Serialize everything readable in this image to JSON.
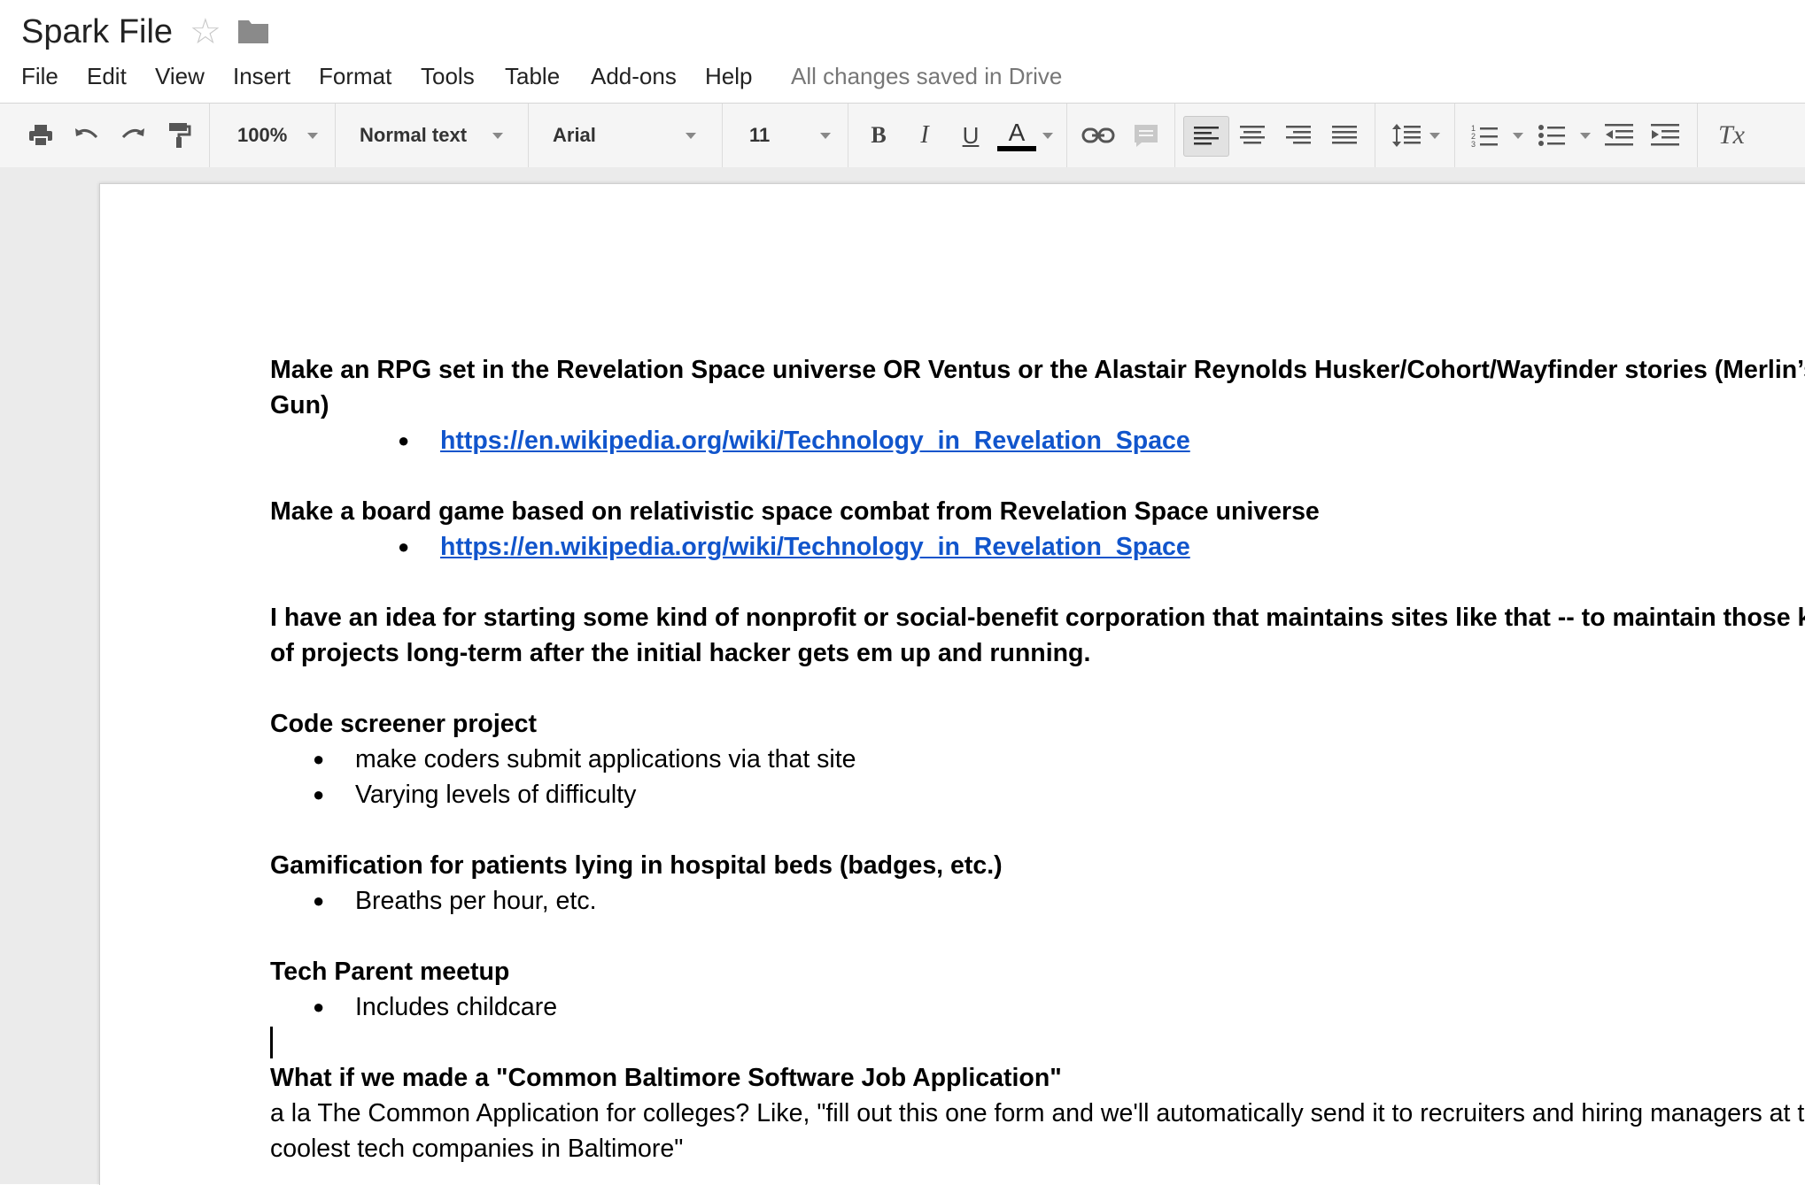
{
  "app": {
    "title": "Spark File",
    "save_status": "All changes saved in Drive"
  },
  "menu": [
    "File",
    "Edit",
    "View",
    "Insert",
    "Format",
    "Tools",
    "Table",
    "Add-ons",
    "Help"
  ],
  "toolbar": {
    "zoom": "100%",
    "style": "Normal text",
    "font": "Arial",
    "font_size": "11",
    "bold_label": "B",
    "italic_label": "I",
    "underline_label": "U",
    "text_color_label": "A",
    "clear_format_label": "Tx",
    "text_color": "#000000",
    "icons": [
      "print-icon",
      "undo-icon",
      "redo-icon",
      "paint-format-icon",
      "link-icon",
      "comment-icon",
      "align-left-icon",
      "align-center-icon",
      "align-right-icon",
      "align-justify-icon",
      "line-spacing-icon",
      "numbered-list-icon",
      "bulleted-list-icon",
      "decrease-indent-icon",
      "increase-indent-icon",
      "clear-formatting-icon"
    ]
  },
  "document": {
    "p1": "Make an RPG set in the Revelation Space universe OR Ventus or the Alastair Reynolds Husker/Cohort/Wayfinder stories (Merlin’s Gun)",
    "p1_link": "https://en.wikipedia.org/wiki/Technology_in_Revelation_Space",
    "p2": "Make a board game based on relativistic space combat from Revelation Space universe",
    "p2_link": "https://en.wikipedia.org/wiki/Technology_in_Revelation_Space",
    "p3": "I have an idea for starting some kind of nonprofit or social-benefit corporation that maintains sites like that -- to maintain those kinds of projects long-term after the initial hacker gets em up and running.",
    "p4": "Code screener project",
    "p4_bullets": [
      "make coders submit applications via that site",
      "Varying levels of difficulty"
    ],
    "p5": "Gamification for patients lying in hospital beds (badges, etc.)",
    "p5_bullets": [
      "Breaths per hour, etc."
    ],
    "p6": "Tech Parent meetup",
    "p6_bullets": [
      "Includes childcare"
    ],
    "p7": "What if we made a \"Common Baltimore Software Job Application\"",
    "p8": "a la The Common Application for colleges? Like, \"fill out this one form and we'll automatically send it to recruiters and hiring managers at the coolest tech companies in Baltimore\"",
    "bullet_char": "●"
  }
}
